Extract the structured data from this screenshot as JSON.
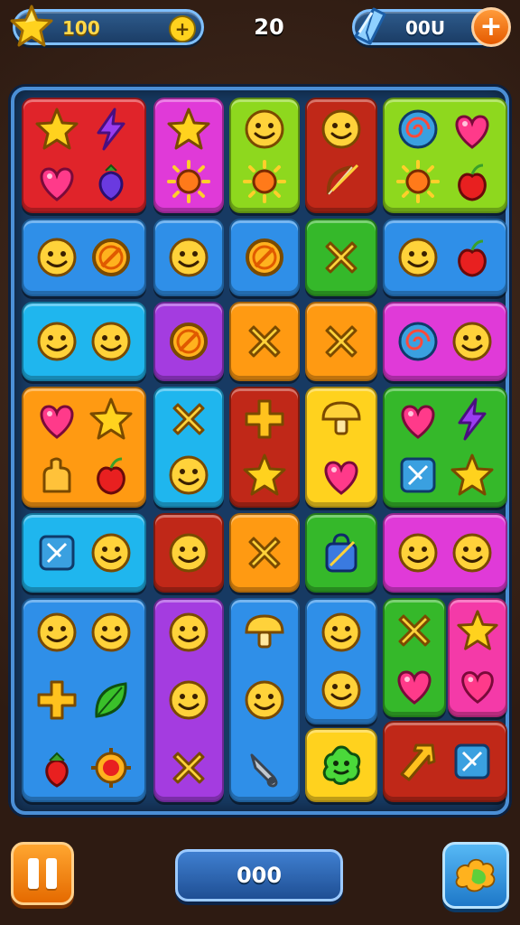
{
  "hud": {
    "stars_value": "100",
    "moves_value": "20",
    "gems_value": "00U",
    "score_value": "000",
    "icons": {
      "star": "star-icon",
      "add_stars": "plus-icon",
      "gem": "gem-icon",
      "add_gems": "plus-icon",
      "pause": "pause-icon",
      "booster": "paint-splash-icon"
    }
  },
  "colors": {
    "red": "#e0242a",
    "magenta": "#e03ad8",
    "lime": "#8ed81e",
    "darkred": "#c02818",
    "blue": "#2f8fe8",
    "cyan": "#1fb6ee",
    "purple": "#a43ce0",
    "orange": "#ff9a12",
    "yellow": "#ffd21e",
    "green": "#35b82a",
    "pink": "#f43aa8"
  },
  "board": {
    "tiles": [
      {
        "color": "red",
        "icons": [
          "star",
          "bolt",
          "heart",
          "strawberry"
        ]
      },
      {
        "color": "magenta",
        "icons": [
          "star",
          "sun"
        ]
      },
      {
        "color": "lime",
        "icons": [
          "smiley",
          "sun"
        ]
      },
      {
        "color": "darkred",
        "icons": [
          "smiley",
          "bow"
        ]
      },
      {
        "color": "lime",
        "icons": [
          "swirl",
          "heart",
          "sun",
          "apple"
        ]
      },
      {
        "color": "blue",
        "icons": [
          "smiley",
          "no-sign"
        ]
      },
      {
        "color": "blue",
        "icons": [
          "smiley"
        ]
      },
      {
        "color": "blue",
        "icons": [
          "no-sign"
        ]
      },
      {
        "color": "green",
        "icons": [
          "cross"
        ]
      },
      {
        "color": "blue",
        "icons": [
          "smiley",
          "apple"
        ]
      },
      {
        "color": "cyan",
        "icons": [
          "smiley",
          "smiley"
        ]
      },
      {
        "color": "purple",
        "icons": [
          "no-sign"
        ]
      },
      {
        "color": "orange",
        "icons": [
          "cross"
        ]
      },
      {
        "color": "orange",
        "icons": [
          "cross"
        ]
      },
      {
        "color": "magenta",
        "icons": [
          "swirl",
          "smiley"
        ]
      },
      {
        "color": "orange",
        "icons": [
          "heart",
          "star",
          "hand",
          "apple"
        ]
      },
      {
        "color": "cyan",
        "icons": [
          "cross",
          "smiley"
        ]
      },
      {
        "color": "darkred",
        "icons": [
          "plus",
          "star"
        ]
      },
      {
        "color": "yellow",
        "icons": [
          "mushroom",
          "heart"
        ]
      },
      {
        "color": "green",
        "icons": [
          "heart",
          "bolt",
          "box-x",
          "star"
        ]
      },
      {
        "color": "cyan",
        "icons": [
          "box-x",
          "smiley"
        ]
      },
      {
        "color": "darkred",
        "icons": [
          "smiley"
        ]
      },
      {
        "color": "orange",
        "icons": [
          "cross"
        ]
      },
      {
        "color": "green",
        "icons": [
          "bag"
        ]
      },
      {
        "color": "magenta",
        "icons": [
          "smiley",
          "smiley"
        ]
      },
      {
        "color": "blue",
        "icons": [
          "smiley",
          "smiley",
          "plus",
          "leaf",
          "berry",
          "gear"
        ]
      },
      {
        "color": "purple",
        "icons": [
          "smiley",
          "smiley",
          "cross"
        ]
      },
      {
        "color": "blue",
        "icons": [
          "mushroom",
          "smiley",
          "tool"
        ]
      },
      {
        "color": "blue",
        "icons": [
          "smiley",
          "smiley"
        ]
      },
      {
        "color": "yellow",
        "icons": [
          "blob"
        ]
      },
      {
        "color": "green",
        "icons": [
          "cross",
          "heart"
        ]
      },
      {
        "color": "pink",
        "icons": [
          "star",
          "heart"
        ]
      },
      {
        "color": "darkred",
        "icons": [
          "arrow",
          "box-x"
        ]
      }
    ]
  }
}
